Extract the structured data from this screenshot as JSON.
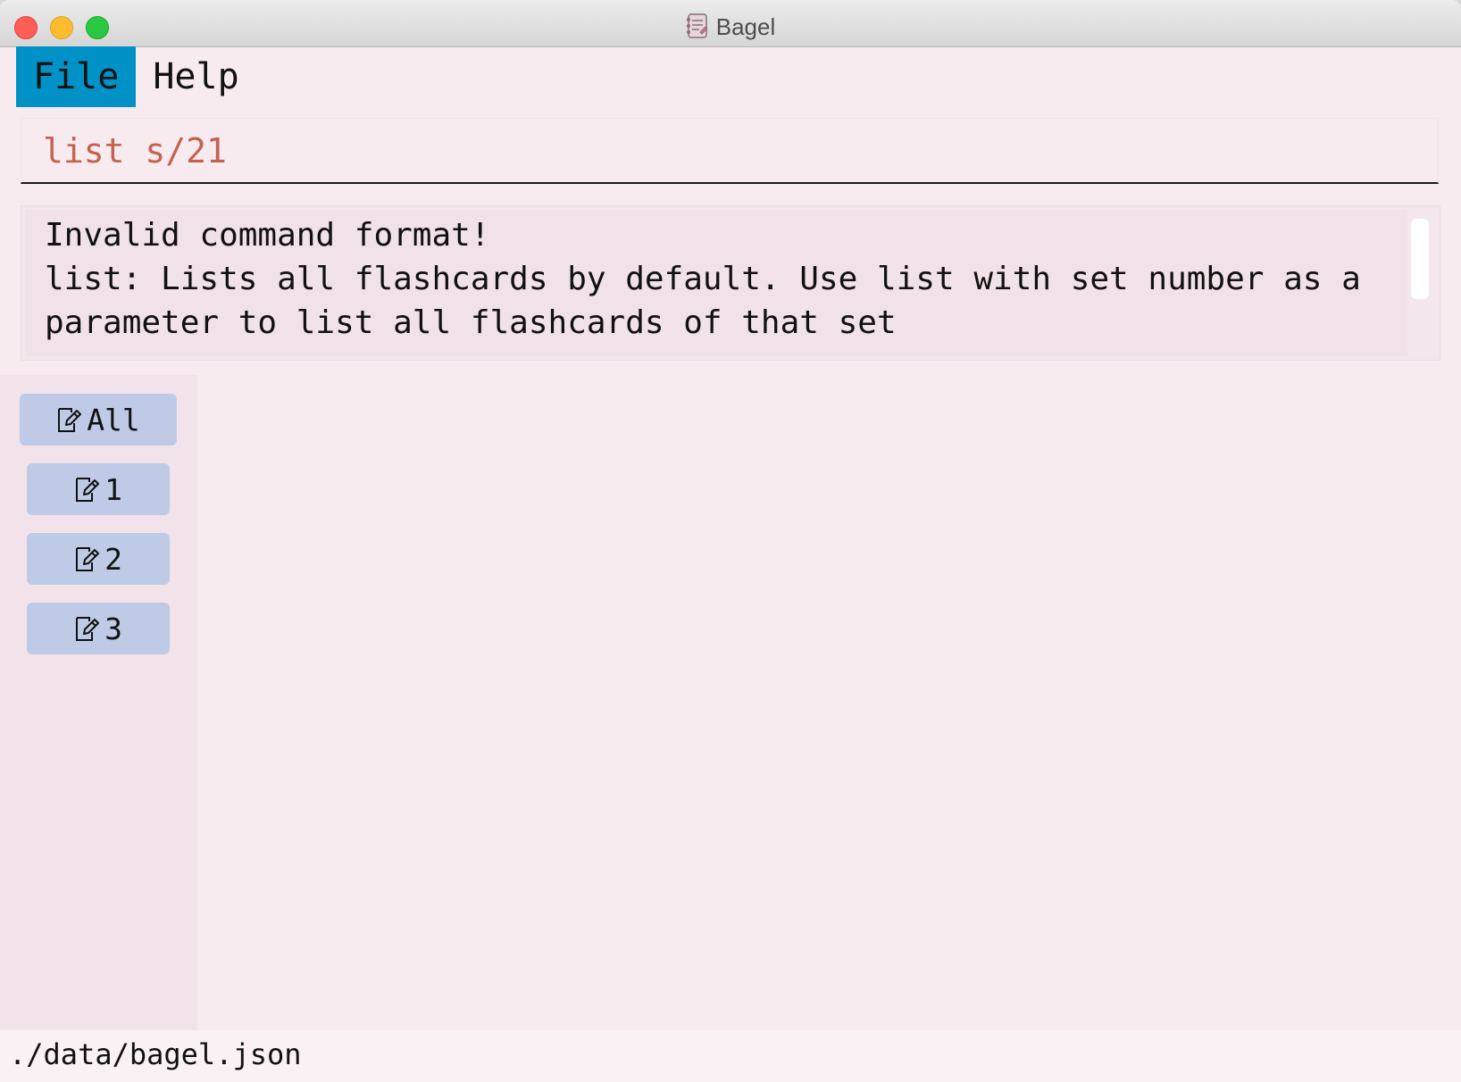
{
  "window": {
    "title": "Bagel",
    "icon": "notebook-app-icon"
  },
  "menu": {
    "items": [
      {
        "label": "File",
        "active": true
      },
      {
        "label": "Help",
        "active": false
      }
    ]
  },
  "command": {
    "value": "list s/21",
    "text_color": "#c4624f"
  },
  "result": {
    "lines": [
      "Invalid command format!",
      "list: Lists all flashcards by default. Use list with set number as a",
      "parameter to list all flashcards of that set"
    ]
  },
  "sidebar": {
    "icon": "edit-note-icon",
    "buttons": [
      {
        "label": "All"
      },
      {
        "label": "1"
      },
      {
        "label": "2"
      },
      {
        "label": "3"
      }
    ]
  },
  "status": {
    "path": "./data/bagel.json"
  },
  "colors": {
    "menu_active": "#0092c7",
    "button_bg": "#bfcbe6",
    "window_bg": "#f7ebf0"
  }
}
